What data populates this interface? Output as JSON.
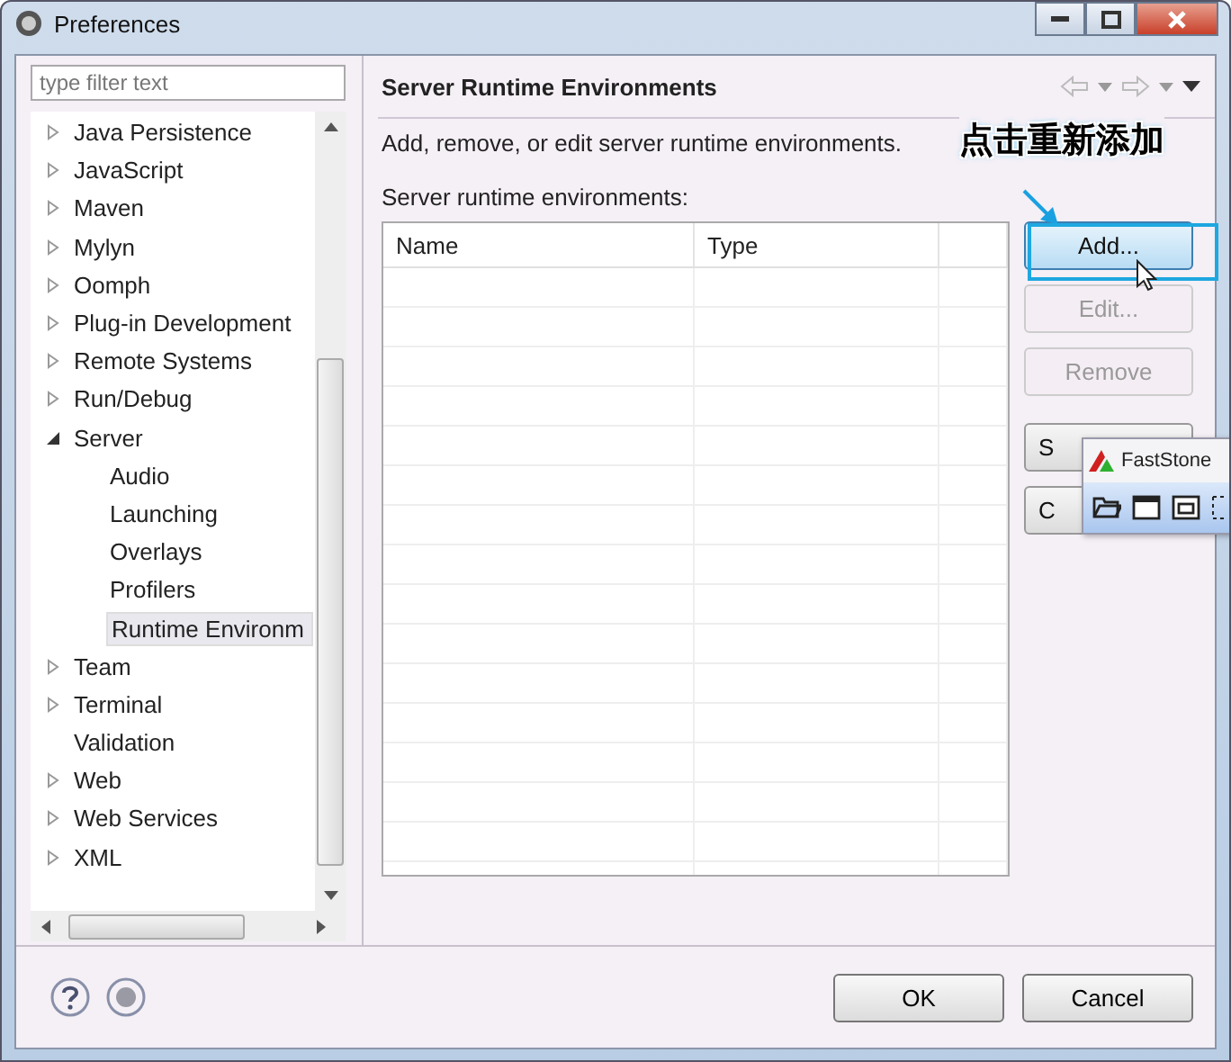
{
  "window": {
    "title": "Preferences"
  },
  "filter": {
    "placeholder": "type filter text"
  },
  "tree": [
    {
      "label": "Java Persistence",
      "kind": "group",
      "expanded": false,
      "selected": false
    },
    {
      "label": "JavaScript",
      "kind": "group",
      "expanded": false,
      "selected": false
    },
    {
      "label": "Maven",
      "kind": "group",
      "expanded": false,
      "selected": false
    },
    {
      "label": "Mylyn",
      "kind": "group",
      "expanded": false,
      "selected": false
    },
    {
      "label": "Oomph",
      "kind": "group",
      "expanded": false,
      "selected": false
    },
    {
      "label": "Plug-in Development",
      "kind": "group",
      "expanded": false,
      "selected": false
    },
    {
      "label": "Remote Systems",
      "kind": "group",
      "expanded": false,
      "selected": false
    },
    {
      "label": "Run/Debug",
      "kind": "group",
      "expanded": false,
      "selected": false
    },
    {
      "label": "Server",
      "kind": "group",
      "expanded": true,
      "selected": false,
      "children": [
        {
          "label": "Audio",
          "selected": false
        },
        {
          "label": "Launching",
          "selected": false
        },
        {
          "label": "Overlays",
          "selected": false
        },
        {
          "label": "Profilers",
          "selected": false
        },
        {
          "label": "Runtime Environm",
          "selected": true
        }
      ]
    },
    {
      "label": "Team",
      "kind": "group",
      "expanded": false,
      "selected": false
    },
    {
      "label": "Terminal",
      "kind": "group",
      "expanded": false,
      "selected": false
    },
    {
      "label": "Validation",
      "kind": "page",
      "selected": false
    },
    {
      "label": "Web",
      "kind": "group",
      "expanded": false,
      "selected": false
    },
    {
      "label": "Web Services",
      "kind": "group",
      "expanded": false,
      "selected": false
    },
    {
      "label": "XML",
      "kind": "group",
      "expanded": false,
      "selected": false
    }
  ],
  "page": {
    "title": "Server Runtime Environments",
    "description": "Add, remove, or edit server runtime environments.",
    "list_label": "Server runtime environments:"
  },
  "table": {
    "columns": [
      "Name",
      "Type"
    ]
  },
  "side_buttons": [
    {
      "label": "Add...",
      "disabled": false,
      "highlighted": true
    },
    {
      "label": "Edit...",
      "disabled": true,
      "highlighted": false
    },
    {
      "label": "Remove",
      "disabled": true,
      "highlighted": false
    },
    {
      "label": "S",
      "disabled": false,
      "highlighted": false
    },
    {
      "label": "C",
      "disabled": false,
      "highlighted": false
    }
  ],
  "annotation": {
    "text": "点击重新添加"
  },
  "popup": {
    "title": "FastStone"
  },
  "buttons": [
    "OK",
    "Cancel"
  ]
}
